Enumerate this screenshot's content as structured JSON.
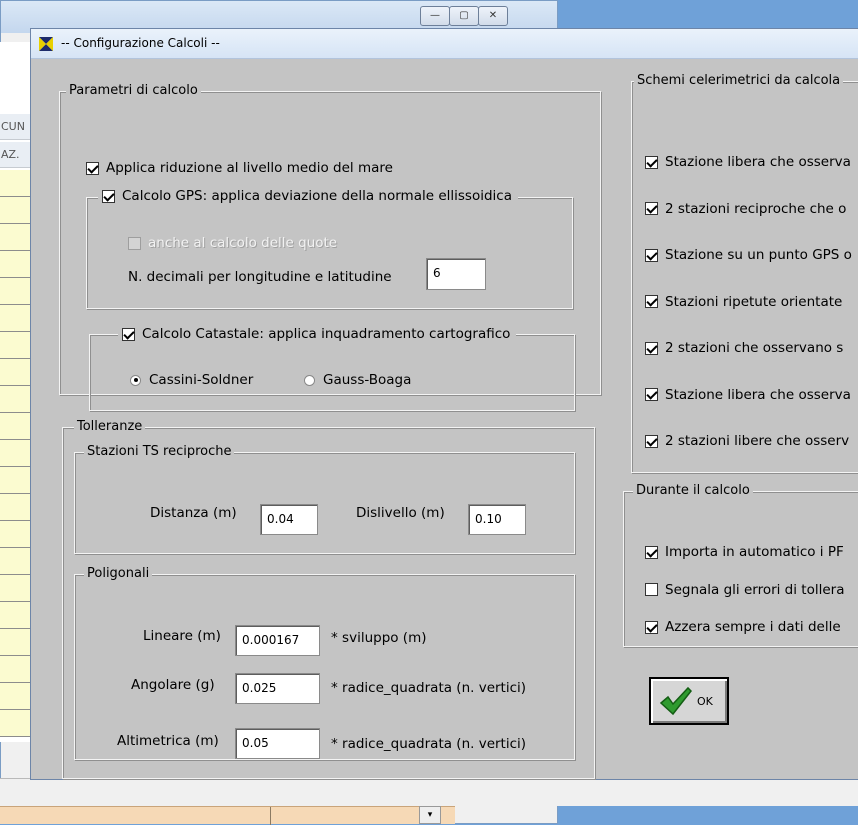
{
  "background": {
    "grid_header_1": "CUN",
    "grid_header_2": "AZ."
  },
  "dialog": {
    "title": "-- Configurazione Calcoli --"
  },
  "parametri": {
    "legend": "Parametri di calcolo",
    "riduzione_label": "Applica riduzione al livello medio del mare",
    "riduzione_checked": true,
    "gps_label": "Calcolo GPS: applica deviazione della normale ellissoidica",
    "gps_checked": true,
    "quote_label": "anche al calcolo delle quote",
    "quote_checked": false,
    "decimali_label": "N. decimali per longitudine e latitudine",
    "decimali_value": "6",
    "catastale_label": "Calcolo Catastale: applica inquadramento cartografico",
    "catastale_checked": true,
    "radio_cassini": "Cassini-Soldner",
    "radio_gauss": "Gauss-Boaga",
    "radio_selected": "Cassini-Soldner"
  },
  "tolleranze": {
    "legend": "Tolleranze",
    "ts_legend": "Stazioni TS reciproche",
    "distanza_label": "Distanza (m)",
    "distanza_value": "0.04",
    "dislivello_label": "Dislivello (m)",
    "dislivello_value": "0.10",
    "poligonali_legend": "Poligonali",
    "lineare_label": "Lineare (m)",
    "lineare_value": "0.000167",
    "lineare_suffix": "* sviluppo (m)",
    "angolare_label": "Angolare (g)",
    "angolare_value": "0.025",
    "angolare_suffix": "* radice_quadrata (n. vertici)",
    "altimetrica_label": "Altimetrica (m)",
    "altimetrica_value": "0.05",
    "altimetrica_suffix": "* radice_quadrata (n. vertici)"
  },
  "schemi": {
    "legend": "Schemi celerimetrici da calcola",
    "items": [
      {
        "label": "Stazione libera che osserva",
        "checked": true
      },
      {
        "label": "2 stazioni reciproche che o",
        "checked": true
      },
      {
        "label": "Stazione su un punto GPS o",
        "checked": true
      },
      {
        "label": "Stazioni ripetute orientate",
        "checked": true
      },
      {
        "label": "2 stazioni che osservano s",
        "checked": true
      },
      {
        "label": "Stazione libera che osserva",
        "checked": true
      },
      {
        "label": "2 stazioni libere che osserv",
        "checked": true
      }
    ]
  },
  "durante": {
    "legend": "Durante il calcolo",
    "items": [
      {
        "label": "Importa in automatico i PF",
        "checked": true
      },
      {
        "label": "Segnala gli errori di tollera",
        "checked": false
      },
      {
        "label": "Azzera sempre i dati delle",
        "checked": true
      }
    ]
  },
  "ok_button": {
    "label": "OK",
    "icon": "checkmark-icon"
  },
  "colors": {
    "dialog_bg": "#c4c4c4",
    "grid_row": "#fbfbd0",
    "desktop": "#6fa1d8",
    "check_green": "#3aa53a"
  }
}
